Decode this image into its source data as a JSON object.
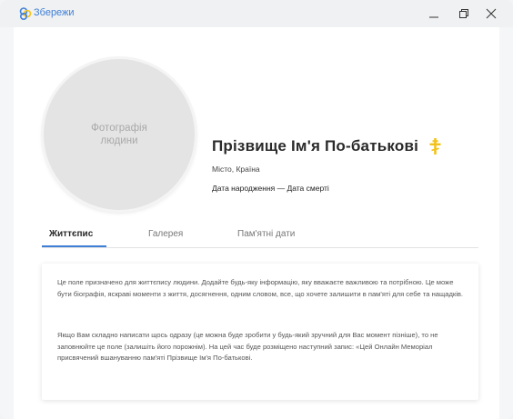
{
  "window": {
    "app_title": "Збережи",
    "brand_color": "#3f7fd6"
  },
  "profile": {
    "photo_placeholder": "Фотографія людини",
    "name": "Прізвище Ім'я По-батькові",
    "cross_icon": "orthodox-cross-icon",
    "cross_color": "#f2c21b",
    "place": "Місто, Країна",
    "dates": "Дата народження — Дата смерті"
  },
  "tabs": [
    {
      "label": "Життєпис",
      "active": true
    },
    {
      "label": "Галерея",
      "active": false
    },
    {
      "label": "Пам'ятні дати",
      "active": false
    }
  ],
  "bio": {
    "paragraph1": "Це поле призначено для життєпису людини. Додайте будь-яку інформацію, яку вважаєте важливою та потрібною. Це може бути біографія, яскраві моменти з життя, досягнення, одним словом, все, що хочете залишити в пам'яті для себе та нащадків.",
    "paragraph2": "Якщо Вам складно написати щось одразу (це можна буде зробити у будь-який зручний для Вас момент пізніше), то не заповнюйте це поле (залишіть його порожнім). На цей час буде розміщено наступний запис: «Цей Онлайн Меморіал присвячений вшануванню пам'яті Прізвище Ім'я По-батькові."
  }
}
